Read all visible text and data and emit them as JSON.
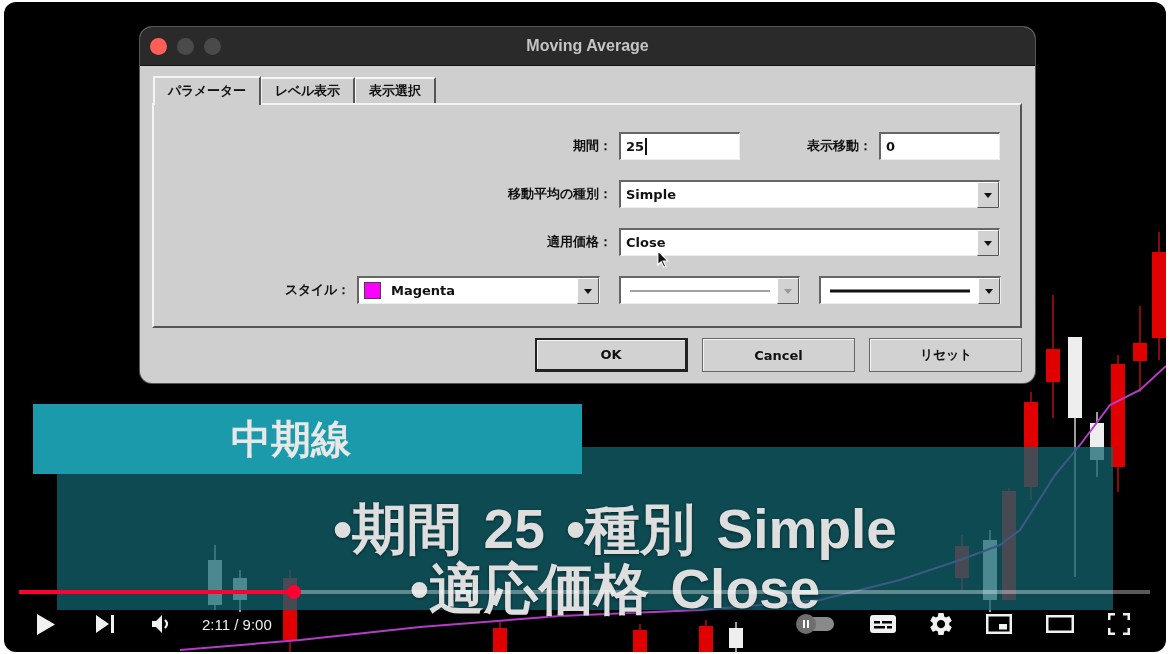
{
  "video": {
    "dialog": {
      "title": "Moving Average",
      "tabs": [
        {
          "label": "パラメーター",
          "selected": true
        },
        {
          "label": "レベル表示",
          "selected": false
        },
        {
          "label": "表示選択",
          "selected": false
        }
      ],
      "rows": [
        {
          "fields": [
            {
              "kind": "input",
              "label": "期間：",
              "value": "25",
              "focused": true
            },
            {
              "kind": "input",
              "label": "表示移動：",
              "value": "0",
              "focused": false
            }
          ]
        },
        {
          "fields": [
            {
              "kind": "select",
              "label": "移動平均の種別：",
              "value": "Simple",
              "disabled": false
            }
          ]
        },
        {
          "fields": [
            {
              "kind": "select",
              "label": "適用価格：",
              "value": "Close",
              "disabled": false
            }
          ]
        },
        {
          "fields": [
            {
              "kind": "color",
              "label": "スタイル：",
              "value": "Magenta",
              "color": "#ff00ff",
              "disabled": false
            },
            {
              "kind": "line",
              "thick": false,
              "disabled": true
            },
            {
              "kind": "line",
              "thick": true,
              "disabled": false
            }
          ]
        }
      ],
      "buttons": [
        {
          "label": "OK",
          "default": true
        },
        {
          "label": "Cancel",
          "default": false
        },
        {
          "label": "リセット",
          "default": false
        }
      ]
    },
    "captions": {
      "heading": "中期線",
      "lines": [
        "•期間 25 •種別 Simple",
        "•適応価格 Close"
      ]
    }
  },
  "player": {
    "playing": false,
    "progress": {
      "level": 0.243
    },
    "time": "2:11 / 9:00",
    "autoplay": false
  }
}
